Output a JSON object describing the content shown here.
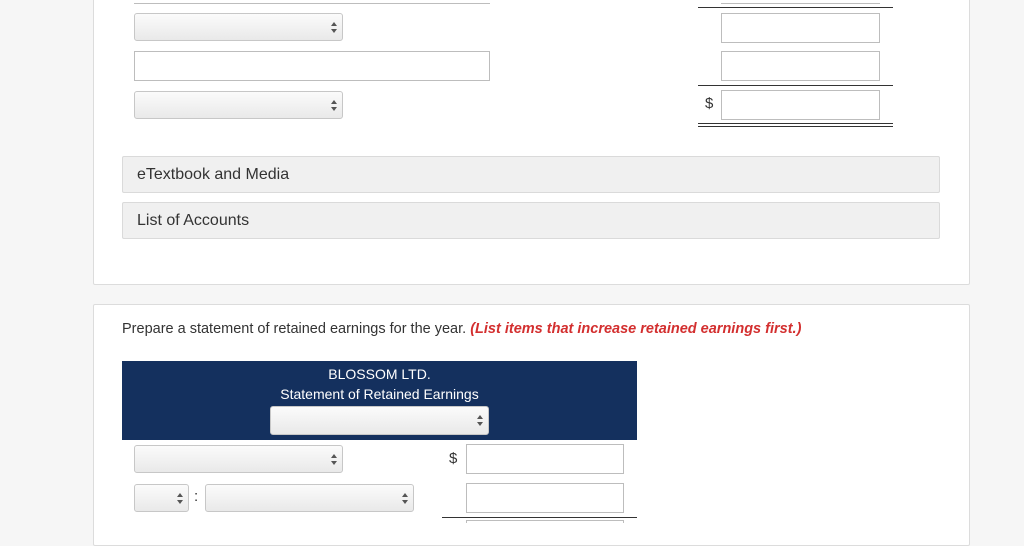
{
  "top_section": {
    "dollar_sign": "$",
    "links": {
      "etextbook": "eTextbook and Media",
      "list_of_accounts": "List of Accounts"
    }
  },
  "retained_section": {
    "instruction": "Prepare a statement of retained earnings for the year.",
    "instruction_note": "(List items that increase retained earnings first.)",
    "company_name": "BLOSSOM LTD.",
    "statement_title": "Statement of Retained Earnings",
    "dollar_sign": "$",
    "colon": ":"
  }
}
